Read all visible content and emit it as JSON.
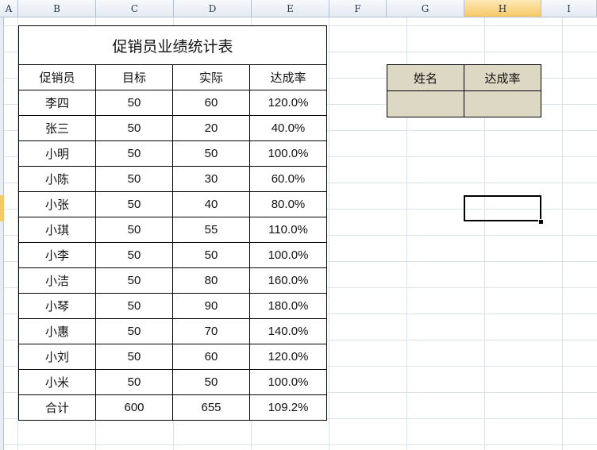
{
  "columns": [
    "A",
    "B",
    "C",
    "D",
    "E",
    "F",
    "G",
    "H",
    "I"
  ],
  "stats_table": {
    "title": "促销员业绩统计表",
    "headers": [
      "促销员",
      "目标",
      "实际",
      "达成率"
    ],
    "rows": [
      [
        "李四",
        "50",
        "60",
        "120.0%"
      ],
      [
        "张三",
        "50",
        "20",
        "40.0%"
      ],
      [
        "小明",
        "50",
        "50",
        "100.0%"
      ],
      [
        "小陈",
        "50",
        "30",
        "60.0%"
      ],
      [
        "小张",
        "50",
        "40",
        "80.0%"
      ],
      [
        "小琪",
        "50",
        "55",
        "110.0%"
      ],
      [
        "小李",
        "50",
        "50",
        "100.0%"
      ],
      [
        "小洁",
        "50",
        "80",
        "160.0%"
      ],
      [
        "小琴",
        "50",
        "90",
        "180.0%"
      ],
      [
        "小惠",
        "50",
        "70",
        "140.0%"
      ],
      [
        "小刘",
        "50",
        "60",
        "120.0%"
      ],
      [
        "小米",
        "50",
        "50",
        "100.0%"
      ]
    ],
    "total": [
      "合计",
      "600",
      "655",
      "109.2%"
    ]
  },
  "lookup_table": {
    "headers": [
      "姓名",
      "达成率"
    ],
    "values": [
      "",
      ""
    ]
  },
  "colors": {
    "lookup_fill": "#ddd8c3",
    "active_header": "#f7c865",
    "grid_line": "#dbe2ea"
  }
}
